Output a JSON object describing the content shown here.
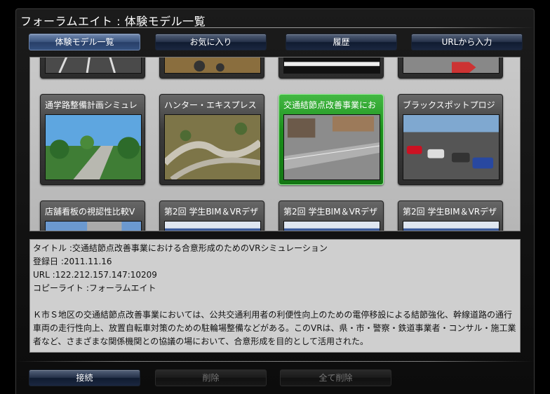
{
  "window": {
    "title": "フォーラムエイト : 体験モデル一覧"
  },
  "tabs": [
    {
      "label": "体験モデル一覧",
      "active": true
    },
    {
      "label": "お気に入り",
      "active": false
    },
    {
      "label": "履歴",
      "active": false
    },
    {
      "label": "URLから入力",
      "active": false
    }
  ],
  "gallery": {
    "row_top": [
      {
        "title": ""
      },
      {
        "title": ""
      },
      {
        "title": ""
      },
      {
        "title": ""
      }
    ],
    "row_middle": [
      {
        "title": "通学路整備計画シミュレ",
        "selected": false
      },
      {
        "title": "ハンター・エキスプレス",
        "selected": false
      },
      {
        "title": "交通結節点改善事業にお",
        "selected": true
      },
      {
        "title": "ブラックスポットプロジ",
        "selected": false
      }
    ],
    "row_bottom": [
      {
        "title": "店舗看板の視認性比較V"
      },
      {
        "title": "第2回 学生BIM＆VRデザ"
      },
      {
        "title": "第2回 学生BIM＆VRデザ"
      },
      {
        "title": "第2回 学生BIM＆VRデザ"
      }
    ]
  },
  "details": {
    "title_line": "タイトル :交通結節点改善事業における合意形成のためのVRシミュレーション",
    "date_line": "登録日 :2011.11.16",
    "url_line": "URL :122.212.157.147:10209",
    "copyright_line": "コピーライト :フォーラムエイト",
    "description": "Ｋ市Ｓ地区の交通結節点改善事業においては、公共交通利用者の利便性向上のための電停移設による結節強化、幹線道路の通行車両の走行性向上、放置自転車対策のための駐輪場整備などがある。このVRは、県・市・警察・鉄道事業者・コンサル・施工業者など、さまざまな関係機関との協議の場において、合意形成を目的として活用された。"
  },
  "actions": [
    {
      "label": "接続",
      "enabled": true
    },
    {
      "label": "削除",
      "enabled": false
    },
    {
      "label": "全て削除",
      "enabled": false
    }
  ],
  "colors": {
    "selected_card": "#1b8f1b",
    "active_tab": "#3c5680",
    "details_bg": "#cfcfcf"
  }
}
